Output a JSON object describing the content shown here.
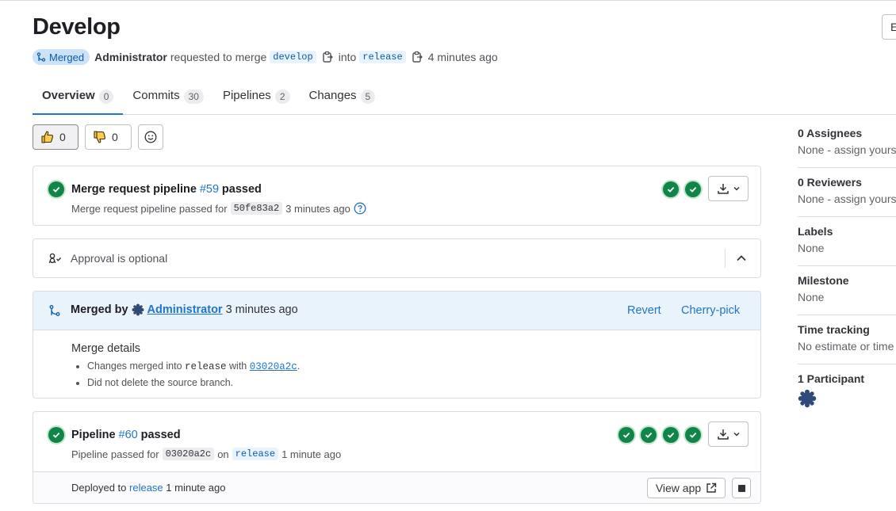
{
  "header": {
    "title": "Develop",
    "edge_button": "E",
    "status_badge": "Merged",
    "author": "Administrator",
    "requested_text": "requested to merge",
    "source_branch": "develop",
    "into_text": "into",
    "target_branch": "release",
    "time": "4 minutes ago"
  },
  "tabs": [
    {
      "label": "Overview",
      "count": "0"
    },
    {
      "label": "Commits",
      "count": "30"
    },
    {
      "label": "Pipelines",
      "count": "2"
    },
    {
      "label": "Changes",
      "count": "5"
    }
  ],
  "reactions": {
    "thumbs_up": "0",
    "thumbs_down": "0"
  },
  "mr_pipeline": {
    "title_prefix": "Merge request pipeline",
    "pipeline_id": "#59",
    "title_suffix": "passed",
    "sub_prefix": "Merge request pipeline passed for",
    "sha": "50fe83a2",
    "sub_time": "3 minutes ago"
  },
  "approval": {
    "text": "Approval is optional"
  },
  "merged": {
    "prefix": "Merged by",
    "user": "Administrator",
    "time": "3 minutes ago",
    "revert": "Revert",
    "cherry_pick": "Cherry-pick",
    "details_title": "Merge details",
    "detail1_prefix": "Changes merged into",
    "detail1_branch": "release",
    "detail1_with": "with",
    "detail1_sha": "03020a2c",
    "detail1_end": ".",
    "detail2": "Did not delete the source branch."
  },
  "pipeline": {
    "title_prefix": "Pipeline",
    "pipeline_id": "#60",
    "title_suffix": "passed",
    "sub_prefix": "Pipeline passed for",
    "sha": "03020a2c",
    "on_text": "on",
    "branch": "release",
    "sub_time": "1 minute ago",
    "deployed_prefix": "Deployed to",
    "environment": "release",
    "deployed_time": "1 minute ago",
    "view_app": "View app"
  },
  "sidebar": {
    "assignees_title": "0 Assignees",
    "assignees_value": "None - assign yourself",
    "reviewers_title": "0 Reviewers",
    "reviewers_value": "None - assign yourself",
    "labels_title": "Labels",
    "labels_value": "None",
    "milestone_title": "Milestone",
    "milestone_value": "None",
    "time_title": "Time tracking",
    "time_value": "No estimate or time spent",
    "participants_title": "1 Participant"
  },
  "colors": {
    "success": "#108548",
    "link": "#1f75cb",
    "merged_bg": "#cbe2f9",
    "merged_header_bg": "#e9f3fc"
  }
}
